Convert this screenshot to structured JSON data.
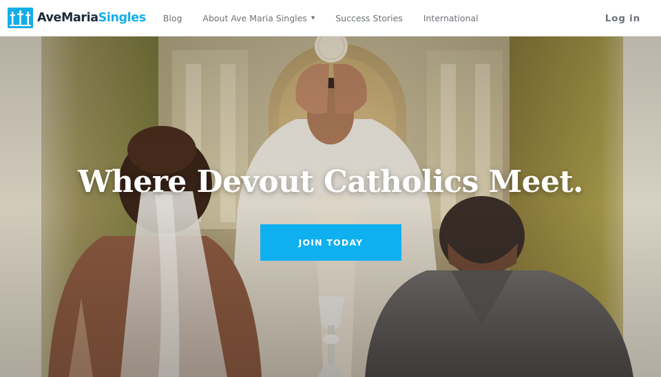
{
  "brand": {
    "name_part1": "AveMaria",
    "name_part2": "Singles",
    "accent_color": "#13aee8",
    "logo_icon": "cross-window-logo-icon"
  },
  "nav": {
    "items": [
      {
        "label": "Blog"
      },
      {
        "label": "About Ave Maria Singles",
        "has_dropdown": true,
        "icon": "caret-down-icon"
      },
      {
        "label": "Success Stories"
      },
      {
        "label": "International"
      }
    ],
    "login_label": "Log in"
  },
  "hero": {
    "headline": "Where Devout Catholics Meet.",
    "cta_label": "JOIN TODAY",
    "cta_color": "#0fb0ef",
    "background_image": "priest-elevating-host-before-kneeling-couple-photo"
  }
}
